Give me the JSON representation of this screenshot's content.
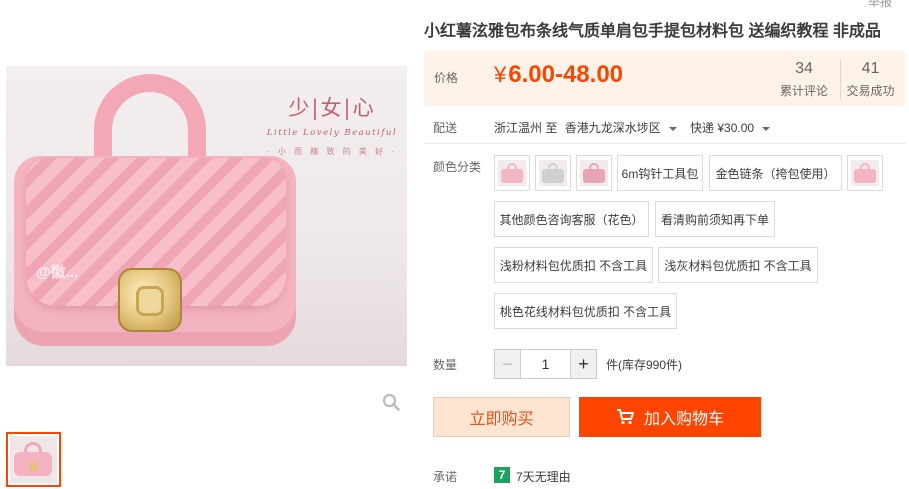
{
  "page": {
    "report_label": "举报"
  },
  "gallery": {
    "banner_brand_main": "少|女|心",
    "banner_brand_sub": "Little Lovely Beautiful",
    "banner_brand_tag": "· 小 而 精 致 的 美 好 ·",
    "watermark": "@徽..."
  },
  "product": {
    "title": "小红薯泫雅包布条线气质单肩包手提包材料包 送编织教程 非成品"
  },
  "price": {
    "label": "价格",
    "currency": "¥",
    "value": "6.00-48.00",
    "stats": [
      {
        "num": "34",
        "label": "累计评论"
      },
      {
        "num": "41",
        "label": "交易成功"
      }
    ]
  },
  "shipping": {
    "label": "配送",
    "from": "浙江温州 至",
    "to": "香港九龙深水埗区",
    "method": "快递 ¥30.00"
  },
  "options": {
    "label": "颜色分类",
    "items": [
      "",
      "",
      "",
      "6m钩针工具包",
      "金色链条（挎包使用）",
      "",
      "其他颜色咨询客服（花色）",
      "看清购前须知再下单",
      "浅粉材料包优质扣 不含工具",
      "浅灰材料包优质扣 不含工具",
      "桃色花线材料包优质扣 不含工具"
    ],
    "swatch_colors": [
      "#f3b7c3",
      "#cfcfcf",
      "#e9a4b6",
      "#f2b4c0"
    ]
  },
  "quantity": {
    "label": "数量",
    "minus": "−",
    "value": "1",
    "plus": "+",
    "stock": "件(库存990件)"
  },
  "actions": {
    "buy_now": "立即购买",
    "add_to_cart": "加入购物车"
  },
  "promise": {
    "label": "承诺",
    "icon_text": "7",
    "text": "7天无理由"
  },
  "colors": {
    "accent": "#ff4400",
    "price_bg": "#fff2e8",
    "buy_bg": "#ffe4d0",
    "promise_green": "#1ca25d"
  }
}
